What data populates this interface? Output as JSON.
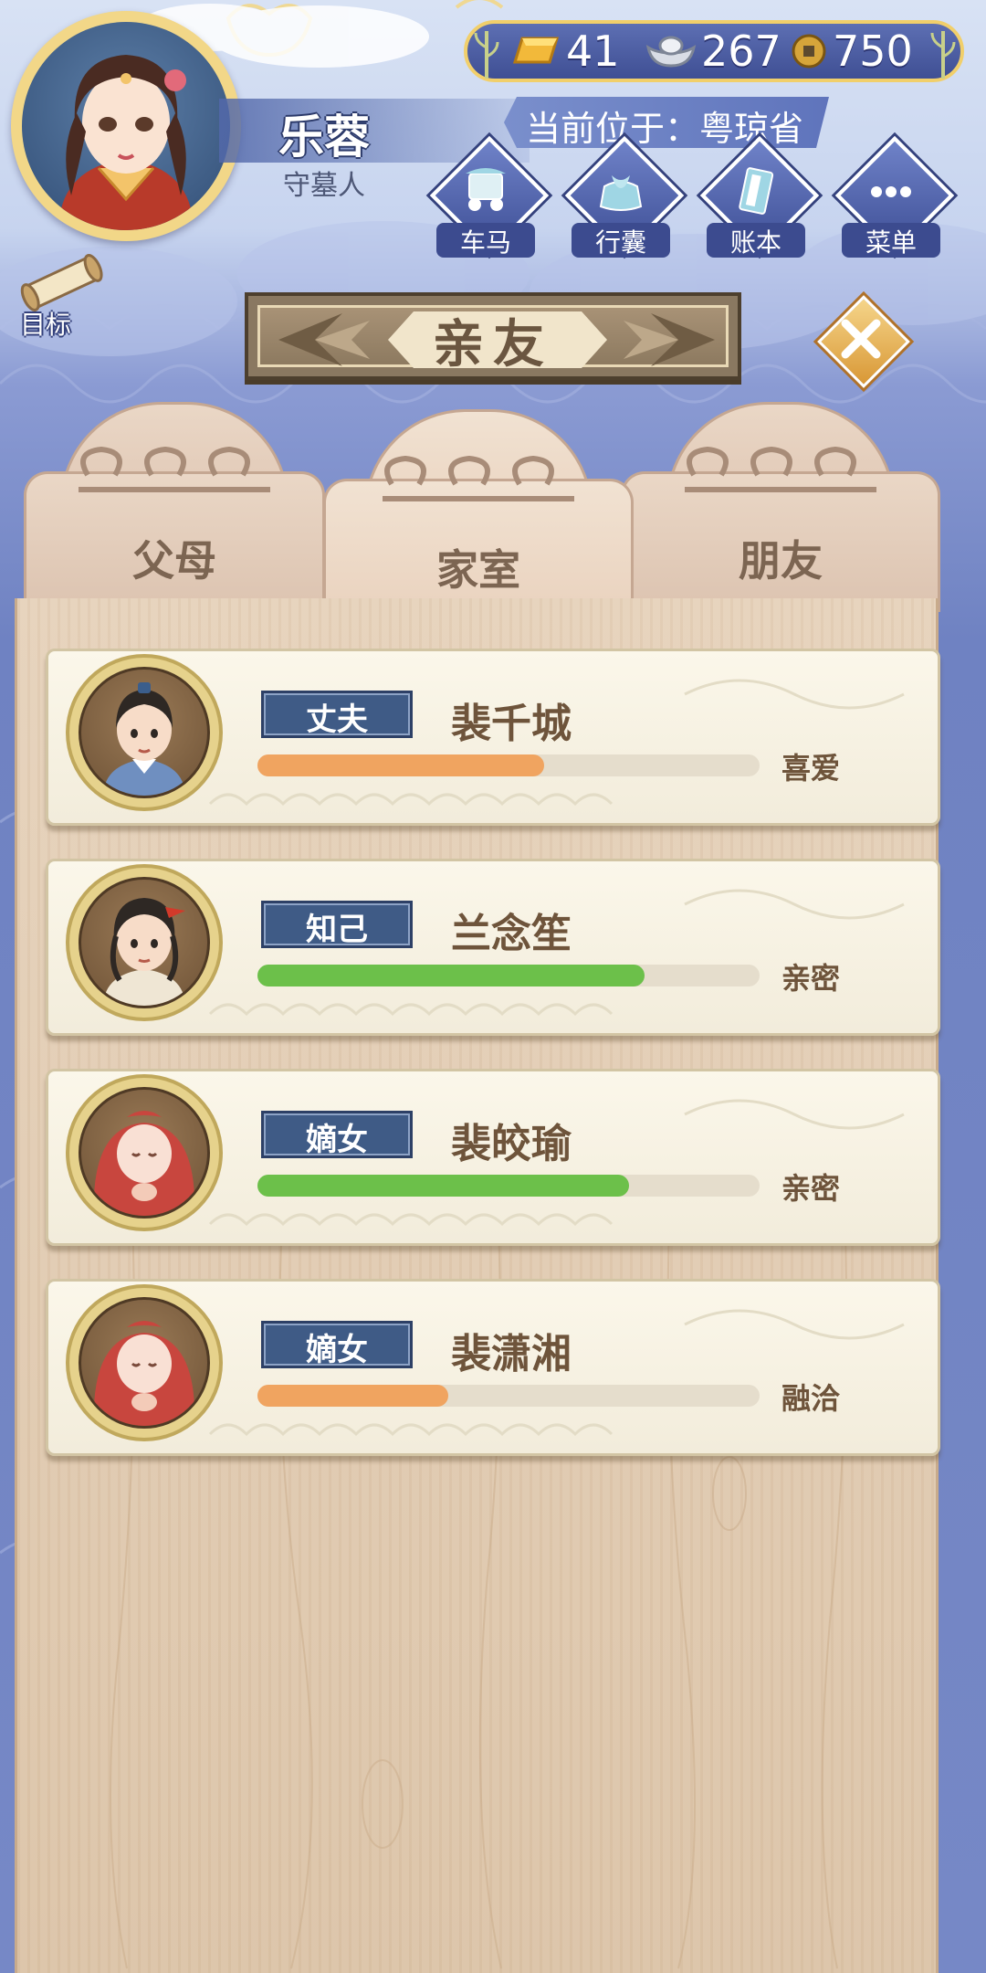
{
  "player": {
    "name": "乐蓉",
    "title": "守墓人"
  },
  "currency": {
    "gold": "41",
    "silver": "267",
    "coins": "750"
  },
  "location": {
    "text": "当前位于：粤琼省"
  },
  "nav": [
    {
      "label": "车马",
      "icon": "carriage-icon"
    },
    {
      "label": "行囊",
      "icon": "bag-icon"
    },
    {
      "label": "账本",
      "icon": "ledger-icon"
    },
    {
      "label": "菜单",
      "icon": "menu-dots-icon"
    }
  ],
  "goal": {
    "label": "目标",
    "icon": "scroll-icon"
  },
  "panel": {
    "title": "亲友"
  },
  "tabs": [
    {
      "label": "父母",
      "active": false
    },
    {
      "label": "家室",
      "active": true
    },
    {
      "label": "朋友",
      "active": false
    }
  ],
  "colors": {
    "bar_orange": "#f0a460",
    "bar_green": "#6cc04a",
    "badge_blue": "#3f5b86",
    "currency_border": "#f1cf6b"
  },
  "relations": [
    {
      "role": "丈夫",
      "name": "裴千城",
      "status": "喜爱",
      "level": 0.57,
      "bar_color": "#f0a460",
      "portrait": "male-adult"
    },
    {
      "role": "知己",
      "name": "兰念笙",
      "status": "亲密",
      "level": 0.77,
      "bar_color": "#6cc04a",
      "portrait": "male-young"
    },
    {
      "role": "嫡女",
      "name": "裴皎瑜",
      "status": "亲密",
      "level": 0.74,
      "bar_color": "#6cc04a",
      "portrait": "baby"
    },
    {
      "role": "嫡女",
      "name": "裴潇湘",
      "status": "融洽",
      "level": 0.38,
      "bar_color": "#f0a460",
      "portrait": "baby"
    }
  ]
}
